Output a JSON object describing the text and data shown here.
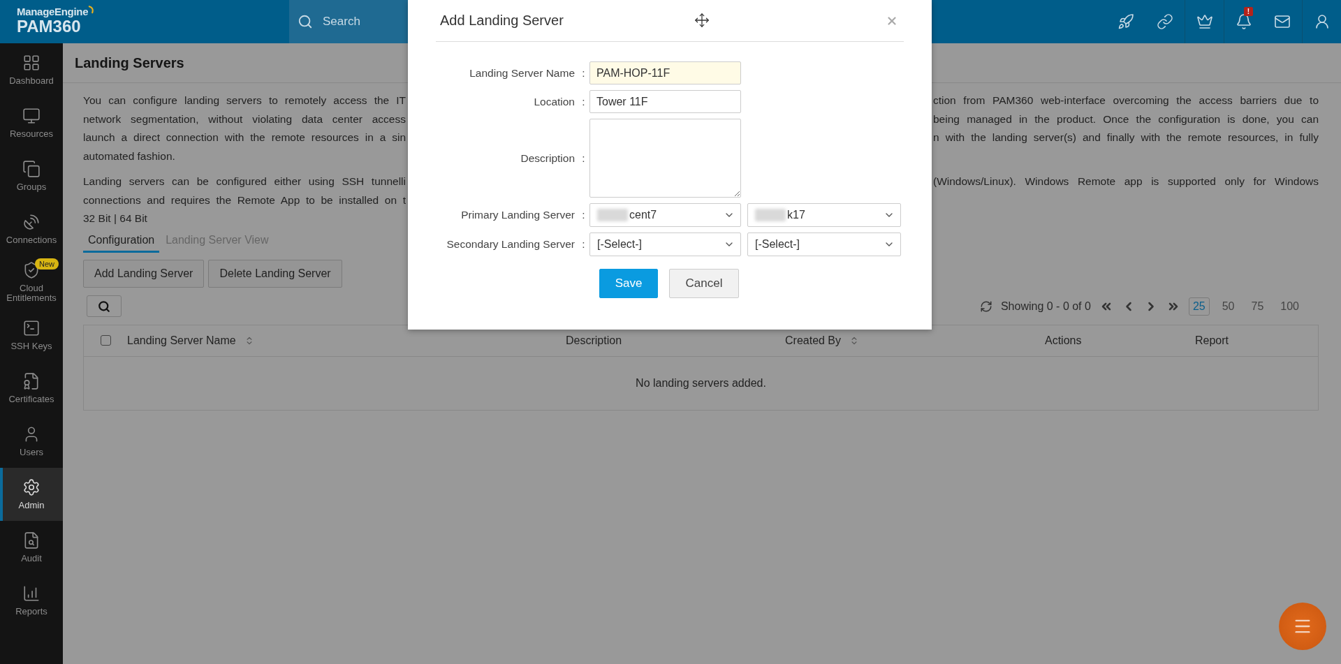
{
  "header": {
    "brand": "ManageEngine",
    "product": "PAM360",
    "search": {
      "placeholder": "Search"
    },
    "notification_badge": "!"
  },
  "sidebar": {
    "items": [
      {
        "label": "Dashboard",
        "kind": "dashboard",
        "selected": false
      },
      {
        "label": "Resources",
        "kind": "resources",
        "selected": false
      },
      {
        "label": "Groups",
        "kind": "groups",
        "selected": false
      },
      {
        "label": "Connections",
        "kind": "connections",
        "selected": false
      },
      {
        "label": "Cloud Entitlements",
        "kind": "cloud",
        "selected": false,
        "badge": "New"
      },
      {
        "label": "SSH Keys",
        "kind": "keys",
        "selected": false
      },
      {
        "label": "Certificates",
        "kind": "certificates",
        "selected": false
      },
      {
        "label": "Users",
        "kind": "users",
        "selected": false
      },
      {
        "label": "Admin",
        "kind": "admin",
        "selected": true
      },
      {
        "label": "Audit",
        "kind": "audit",
        "selected": false
      },
      {
        "label": "Reports",
        "kind": "reports",
        "selected": false
      }
    ]
  },
  "page": {
    "title": "Landing Servers",
    "intro_lines": [
      {
        "left": "You can configure landing servers to remotely access the IT",
        "right": "ction from PAM360 web-interface overcoming the access barriers due to"
      },
      {
        "left": "network segmentation, without violating data center access",
        "right": "being managed in the product. Once the configuration is done, you can"
      },
      {
        "left": "launch a direct connection with the remote resources in a sin",
        "right": "n with the landing server(s) and finally with the remote resources, in fully"
      },
      {
        "left": "automated fashion."
      },
      {
        "left": "Landing servers can be configured either using SSH tunnelli",
        "right": "(Windows/Linux). Windows Remote app is supported only for Windows"
      },
      {
        "left": "connections and requires the Remote App to be installed on t"
      },
      {
        "left": "32 Bit | 64 Bit"
      }
    ],
    "tabs": [
      {
        "label": "Configuration",
        "selected": true
      },
      {
        "label": "Landing Server View",
        "selected": false
      }
    ],
    "buttons": [
      "Add Landing Server",
      "Delete Landing Server"
    ],
    "pagination": {
      "summary": "Showing 0 - 0 of 0",
      "page_sizes": [
        {
          "label": "25",
          "selected": true
        },
        {
          "label": "50",
          "selected": false
        },
        {
          "label": "75",
          "selected": false
        },
        {
          "label": "100",
          "selected": false
        }
      ]
    },
    "table": {
      "select_all_checked": false,
      "columns": [
        {
          "label": "Landing Server Name",
          "sortable": true
        },
        {
          "label": "Description",
          "sortable": false
        },
        {
          "label": "Created By",
          "sortable": true
        },
        {
          "label": "Actions",
          "sortable": false
        },
        {
          "label": "Report",
          "sortable": false
        }
      ],
      "empty_message": "No landing servers added."
    }
  },
  "dialog": {
    "title": "Add Landing Server",
    "fields": [
      {
        "kind": "text",
        "label": "Landing Server Name",
        "separator": ":",
        "value": "PAM-HOP-11F",
        "focused": true
      },
      {
        "kind": "text",
        "label": "Location",
        "separator": ":",
        "value": "Tower 11F",
        "focused": false
      },
      {
        "kind": "textarea",
        "label": "Description",
        "separator": ":"
      },
      {
        "kind": "selects",
        "label": "Primary Landing Server",
        "separator": ":",
        "selects": [
          {
            "value": "cent7",
            "redacted": true
          },
          {
            "value": "k17",
            "redacted": true
          }
        ]
      },
      {
        "kind": "selects",
        "label": "Secondary Landing Server",
        "separator": ":",
        "selects": [
          {
            "value": "[-Select-]",
            "redacted": false
          },
          {
            "value": "[-Select-]",
            "redacted": false
          }
        ]
      }
    ],
    "buttons": [
      {
        "label": "Save",
        "kind": "primary"
      },
      {
        "label": "Cancel",
        "kind": "secondary"
      }
    ]
  }
}
